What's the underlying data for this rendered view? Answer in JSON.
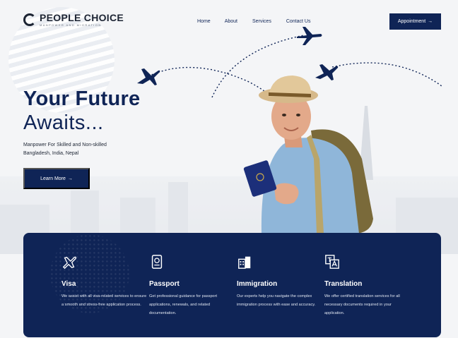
{
  "brand": {
    "name": "PEOPLE CHOICE",
    "tagline": "MANPOWER AND MIGRATION"
  },
  "nav": {
    "items": [
      "Home",
      "About",
      "Services",
      "Contact Us"
    ]
  },
  "header": {
    "appointment_label": "Appointment",
    "appointment_arrow": "→"
  },
  "hero": {
    "title_line1": "Your Future",
    "title_line2": "Awaits...",
    "subtitle_line1": "Manpower For Skilled and Non-skilled",
    "subtitle_line2": "Bangladesh, India, Nepal",
    "cta_label": "Learn More",
    "cta_arrow": "→"
  },
  "services": [
    {
      "icon": "airplane-icon",
      "title": "Visa",
      "description": "We assist with all visa-related services to ensure a smooth and stress-free application process."
    },
    {
      "icon": "passport-icon",
      "title": "Passport",
      "description": "Get professional guidance for passport applications, renewals, and related documentation."
    },
    {
      "icon": "immigration-building-icon",
      "title": "Immigration",
      "description": "Our experts help you navigate the complex immigration process with ease and accuracy."
    },
    {
      "icon": "translation-icon",
      "title": "Translation",
      "description": "We offer certified translation services for all necessary documents required in your application."
    }
  ],
  "colors": {
    "primary": "#0f2456",
    "background": "#f4f5f7",
    "skin": "#e3a98a",
    "shirt": "#8fb6d9",
    "hat": "#d6b98a",
    "backpack": "#7a6a3a"
  }
}
